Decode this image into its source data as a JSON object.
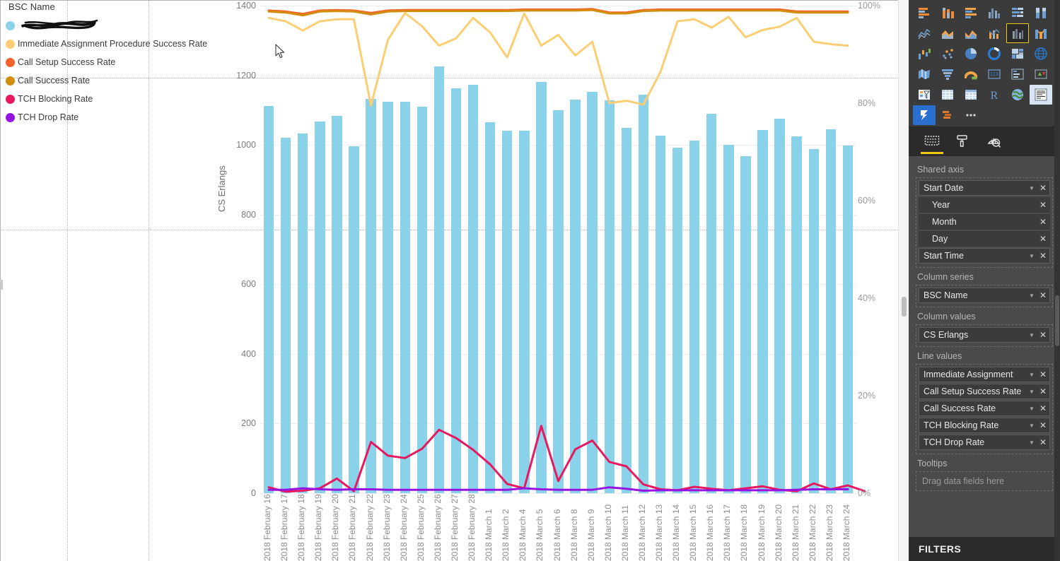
{
  "legend": {
    "title": "BSC Name",
    "items": [
      {
        "label": "",
        "color": "#8ad2ea",
        "redacted": true,
        "name": "bsc-name-series"
      },
      {
        "label": "Immediate Assignment Procedure Success Rate",
        "color": "#fbce74",
        "redacted": false
      },
      {
        "label": "Call Setup Success Rate",
        "color": "#f4622a",
        "redacted": false
      },
      {
        "label": "Call Success Rate",
        "color": "#d28e0e",
        "redacted": false
      },
      {
        "label": "TCH Blocking Rate",
        "color": "#e8185f",
        "redacted": false
      },
      {
        "label": "TCH Drop Rate",
        "color": "#9614e0",
        "redacted": false
      }
    ]
  },
  "chart_data": {
    "type": "line-and-clustered-column",
    "title": "",
    "xlabel": "",
    "ylabel": "CS Erlangs",
    "y2label": "",
    "ylim": [
      0,
      1400
    ],
    "y2lim": [
      0,
      1
    ],
    "yticks": [
      "0",
      "200",
      "400",
      "600",
      "800",
      "1000",
      "1200",
      "1400"
    ],
    "y2ticks": [
      "0%",
      "20%",
      "40%",
      "60%",
      "80%",
      "100%"
    ],
    "grid": true,
    "legend_position": "left",
    "categories": [
      "2018 February 16",
      "2018 February 17",
      "2018 February 18",
      "2018 February 19",
      "2018 February 20",
      "2018 February 21",
      "2018 February 22",
      "2018 February 23",
      "2018 February 24",
      "2018 February 25",
      "2018 February 26",
      "2018 February 27",
      "2018 February 28",
      "2018 March 1",
      "2018 March 2",
      "2018 March 4",
      "2018 March 5",
      "2018 March 6",
      "2018 March 8",
      "2018 March 9",
      "2018 March 10",
      "2018 March 11",
      "2018 March 12",
      "2018 March 13",
      "2018 March 14",
      "2018 March 15",
      "2018 March 16",
      "2018 March 17",
      "2018 March 18",
      "2018 March 19",
      "2018 March 20",
      "2018 March 21",
      "2018 March 22",
      "2018 March 23",
      "2018 March 24"
    ],
    "column_series": {
      "name": "CS Erlangs",
      "color": "#8ad2ea",
      "axis": "left",
      "values": [
        1112,
        1020,
        1032,
        1068,
        1083,
        997,
        1132,
        1125,
        1125,
        1110,
        1225,
        1162,
        1172,
        1065,
        1040,
        1040,
        1180,
        1100,
        1130,
        1152,
        1128,
        1050,
        1145,
        1026,
        992,
        1013,
        1090,
        1000,
        968,
        1043,
        1075,
        1025,
        988,
        1045,
        999
      ]
    },
    "line_series": [
      {
        "name": "Immediate Assignment Procedure Success Rate",
        "color": "#fbce74",
        "axis": "right",
        "values": [
          0.975,
          0.968,
          0.949,
          0.968,
          0.972,
          0.972,
          0.795,
          0.93,
          0.985,
          0.958,
          0.918,
          0.933,
          0.975,
          0.945,
          0.894,
          0.984,
          0.918,
          0.94,
          0.898,
          0.926,
          0.8,
          0.805,
          0.797,
          0.864,
          0.968,
          0.972,
          0.955,
          0.977,
          0.935,
          0.95,
          0.957,
          0.975,
          0.926,
          0.921,
          0.918
        ]
      },
      {
        "name": "Call Setup Success Rate",
        "color": "#f4622a",
        "axis": "right",
        "values": [
          0.99,
          0.988,
          0.983,
          0.99,
          0.991,
          0.99,
          0.985,
          0.99,
          0.991,
          0.991,
          0.991,
          0.991,
          0.991,
          0.991,
          0.991,
          0.992,
          0.992,
          0.992,
          0.992,
          0.993,
          0.986,
          0.986,
          0.991,
          0.992,
          0.992,
          0.992,
          0.992,
          0.992,
          0.992,
          0.992,
          0.992,
          0.988,
          0.988,
          0.988,
          0.988
        ]
      },
      {
        "name": "Call Success Rate",
        "color": "#d28e0e",
        "axis": "right",
        "values": [
          0.988,
          0.986,
          0.98,
          0.988,
          0.989,
          0.988,
          0.982,
          0.988,
          0.989,
          0.989,
          0.989,
          0.989,
          0.989,
          0.989,
          0.989,
          0.99,
          0.99,
          0.99,
          0.99,
          0.991,
          0.984,
          0.984,
          0.989,
          0.99,
          0.99,
          0.99,
          0.99,
          0.99,
          0.99,
          0.99,
          0.99,
          0.986,
          0.986,
          0.986,
          0.986
        ]
      },
      {
        "name": "TCH Blocking Rate",
        "color": "#e8185f",
        "axis": "right",
        "values": [
          0.012,
          0.003,
          0.005,
          0.01,
          0.03,
          0.004,
          0.105,
          0.077,
          0.072,
          0.091,
          0.13,
          0.113,
          0.089,
          0.059,
          0.019,
          0.01,
          0.138,
          0.025,
          0.09,
          0.108,
          0.064,
          0.055,
          0.018,
          0.008,
          0.006,
          0.013,
          0.009,
          0.006,
          0.01,
          0.014,
          0.007,
          0.004,
          0.02,
          0.008,
          0.016,
          0.004
        ]
      },
      {
        "name": "TCH Drop Rate",
        "color": "#9614e0",
        "axis": "right",
        "values": [
          0.007,
          0.007,
          0.01,
          0.008,
          0.007,
          0.008,
          0.008,
          0.007,
          0.007,
          0.007,
          0.007,
          0.007,
          0.007,
          0.007,
          0.007,
          0.01,
          0.008,
          0.007,
          0.007,
          0.007,
          0.012,
          0.009,
          0.005,
          0.006,
          0.006,
          0.006,
          0.006,
          0.006,
          0.006,
          0.006,
          0.006,
          0.007,
          0.008,
          0.008,
          0.008
        ]
      }
    ]
  },
  "visualizations": {
    "gallery": [
      {
        "name": "stacked-bar-chart-icon"
      },
      {
        "name": "stacked-column-chart-icon"
      },
      {
        "name": "clustered-bar-chart-icon"
      },
      {
        "name": "clustered-column-chart-icon"
      },
      {
        "name": "hundred-percent-stacked-bar-chart-icon"
      },
      {
        "name": "hundred-percent-stacked-column-chart-icon"
      },
      {
        "name": "line-chart-icon"
      },
      {
        "name": "area-chart-icon"
      },
      {
        "name": "stacked-area-chart-icon"
      },
      {
        "name": "line-and-stacked-column-chart-icon"
      },
      {
        "name": "line-and-clustered-column-chart-icon",
        "selected": true
      },
      {
        "name": "ribbon-chart-icon"
      },
      {
        "name": "waterfall-chart-icon"
      },
      {
        "name": "scatter-chart-icon"
      },
      {
        "name": "pie-chart-icon"
      },
      {
        "name": "donut-chart-icon"
      },
      {
        "name": "treemap-icon"
      },
      {
        "name": "map-icon"
      },
      {
        "name": "filled-map-icon"
      },
      {
        "name": "funnel-icon"
      },
      {
        "name": "gauge-icon"
      },
      {
        "name": "card-icon"
      },
      {
        "name": "multi-row-card-icon"
      },
      {
        "name": "kpi-icon"
      },
      {
        "name": "slicer-icon"
      },
      {
        "name": "table-icon"
      },
      {
        "name": "matrix-icon"
      },
      {
        "name": "r-script-visual-icon"
      },
      {
        "name": "arcgis-map-icon"
      },
      {
        "name": "paginated-report-icon",
        "highlighted": true
      },
      {
        "name": "power-apps-visual-icon",
        "active": true
      },
      {
        "name": "custom-visual-icon"
      },
      {
        "name": "more-options-icon"
      }
    ],
    "tabs": [
      {
        "name": "fields-tab",
        "icon": "fields-icon",
        "active": true
      },
      {
        "name": "format-tab",
        "icon": "paint-roller-icon",
        "active": false
      },
      {
        "name": "analytics-tab",
        "icon": "magnifier-chart-icon",
        "active": false
      }
    ]
  },
  "fieldwells": [
    {
      "heading": "Shared axis",
      "fields": [
        {
          "label": "Start Date",
          "caret": true,
          "remove": true,
          "sub": false
        },
        {
          "label": "Year",
          "caret": false,
          "remove": true,
          "sub": true
        },
        {
          "label": "Month",
          "caret": false,
          "remove": true,
          "sub": true
        },
        {
          "label": "Day",
          "caret": false,
          "remove": true,
          "sub": true
        },
        {
          "label": "Start Time",
          "caret": true,
          "remove": true,
          "sub": false
        }
      ]
    },
    {
      "heading": "Column series",
      "fields": [
        {
          "label": "BSC Name",
          "caret": true,
          "remove": true,
          "sub": false
        }
      ]
    },
    {
      "heading": "Column values",
      "fields": [
        {
          "label": "CS Erlangs",
          "caret": true,
          "remove": true,
          "sub": false
        }
      ]
    },
    {
      "heading": "Line values",
      "fields": [
        {
          "label": "Immediate Assignment",
          "caret": true,
          "remove": true,
          "sub": false
        },
        {
          "label": "Call Setup Success Rate",
          "caret": true,
          "remove": true,
          "sub": false
        },
        {
          "label": "Call Success Rate",
          "caret": true,
          "remove": true,
          "sub": false
        },
        {
          "label": "TCH Blocking Rate",
          "caret": true,
          "remove": true,
          "sub": false
        },
        {
          "label": "TCH Drop Rate",
          "caret": true,
          "remove": true,
          "sub": false
        }
      ]
    },
    {
      "heading": "Tooltips",
      "fields": [],
      "placeholder": "Drag data fields here"
    }
  ],
  "filters_panel": {
    "title": "FILTERS"
  },
  "colors": {
    "bar": "#8ad2ea",
    "accent_yellow": "#f2c811",
    "panel_bg": "#3b3b3b",
    "well_bg": "#4a4a4a",
    "filters_bg": "#2b2b2b"
  }
}
